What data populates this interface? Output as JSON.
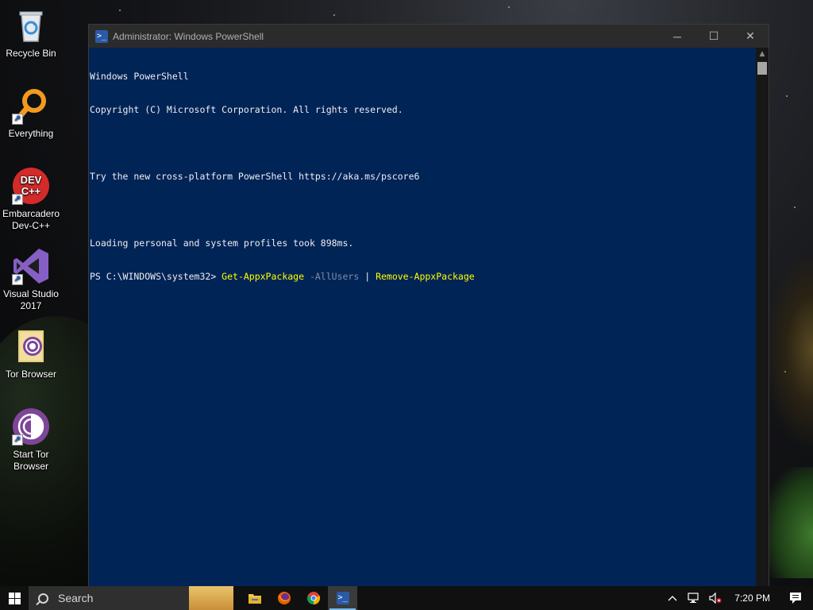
{
  "desktop": {
    "icons": [
      {
        "label": "Recycle Bin",
        "icon": "recycle-bin-icon"
      },
      {
        "label": "Everything",
        "icon": "everything-search-icon"
      },
      {
        "label": "Embarcadero Dev-C++",
        "icon": "devcpp-icon",
        "badge": "DEV C++"
      },
      {
        "label": "Visual Studio 2017",
        "icon": "visual-studio-icon"
      },
      {
        "label": "Tor Browser",
        "icon": "tor-folder-icon"
      },
      {
        "label": "Start Tor Browser",
        "icon": "tor-browser-icon"
      }
    ]
  },
  "window": {
    "title": "Administrator: Windows PowerShell",
    "minimize": "─",
    "maximize": "☐",
    "close": "✕"
  },
  "console": {
    "lines": [
      "Windows PowerShell",
      "Copyright (C) Microsoft Corporation. All rights reserved.",
      "",
      "Try the new cross-platform PowerShell https://aka.ms/pscore6",
      "",
      "Loading personal and system profiles took 898ms."
    ],
    "prompt": "PS C:\\WINDOWS\\system32> ",
    "command1": "Get-AppxPackage",
    "parameter": " -AllUsers ",
    "pipe": "|",
    "command2": " Remove-AppxPackage"
  },
  "taskbar": {
    "search_placeholder": "Search",
    "apps": [
      {
        "name": "File Explorer",
        "icon": "folder-icon"
      },
      {
        "name": "Firefox",
        "icon": "firefox-icon"
      },
      {
        "name": "Chrome",
        "icon": "chrome-icon"
      },
      {
        "name": "Windows PowerShell",
        "icon": "powershell-icon",
        "active": true
      }
    ],
    "clock": "7:20 PM"
  },
  "colors": {
    "console_bg": "#012456",
    "console_text": "#eeedf0",
    "command": "#ffff00",
    "parameter": "#7f8ca8",
    "titlebar": "#2b2b2b"
  }
}
